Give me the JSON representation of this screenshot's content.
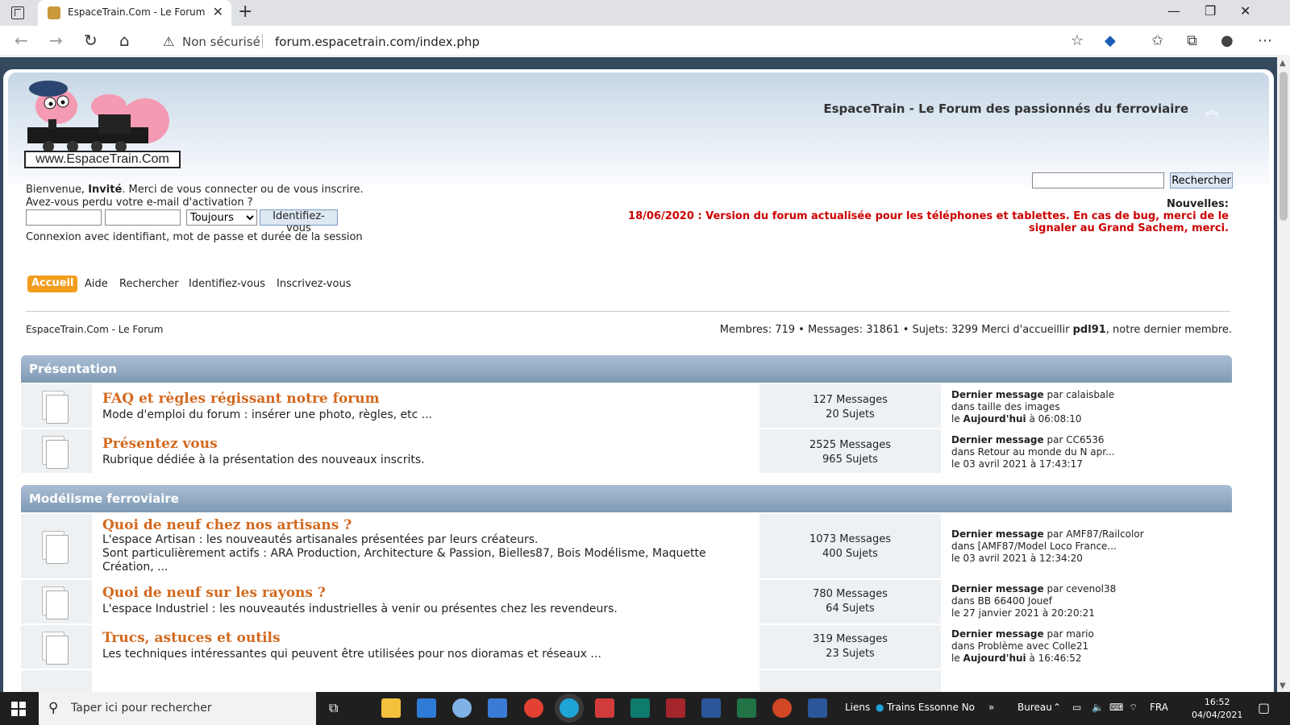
{
  "browser": {
    "tab_title": "EspaceTrain.Com - Le Forum - Accueil",
    "insecure_label": "Non sécurisé",
    "url": "forum.espacetrain.com/index.php"
  },
  "header": {
    "site_title": "EspaceTrain - Le Forum des passionnés du ferroviaire",
    "logo_text": "www.EspaceTrain.Com"
  },
  "login": {
    "welcome_prefix": "Bienvenue, ",
    "guest": "Invité",
    "welcome_suffix": ". Merci de vous connecter ou de vous inscrire.",
    "lost_email": "Avez-vous perdu votre e-mail d'activation ?",
    "duration_selected": "Toujours",
    "login_button": "Identifiez-vous",
    "session_note": "Connexion avec identifiant, mot de passe et durée de la session"
  },
  "search": {
    "button": "Rechercher"
  },
  "news": {
    "label": "Nouvelles:",
    "text": "18/06/2020 : Version du forum actualisée pour les téléphones et tablettes. En cas de bug, merci de le signaler au Grand Sachem, merci."
  },
  "menu": {
    "home": "Accueil",
    "help": "Aide",
    "search": "Rechercher",
    "login": "Identifiez-vous",
    "register": "Inscrivez-vous"
  },
  "breadcrumb": "EspaceTrain.Com - Le Forum",
  "stats": {
    "prefix": "Membres: 719  •  Messages: 31861  •  Sujets: 3299 Merci d'accueillir ",
    "newest_member": "pdl91",
    "suffix": ", notre dernier membre."
  },
  "categories": [
    {
      "name": "Présentation",
      "boards": [
        {
          "name": "FAQ et règles régissant notre forum",
          "desc": "Mode d'emploi du forum : insérer une photo, règles, etc ...",
          "messages": "127 Messages",
          "topics": "20 Sujets",
          "last_label": "Dernier message",
          "last_by": " par calaisbale",
          "last_in": "dans taille des images",
          "last_date_prefix": "le ",
          "last_date_bold": "Aujourd'hui",
          "last_date": " à 06:08:10"
        },
        {
          "name": "Présentez vous",
          "desc": "Rubrique dédiée à la présentation des nouveaux inscrits.",
          "messages": "2525 Messages",
          "topics": "965 Sujets",
          "last_label": "Dernier message",
          "last_by": " par CC6536",
          "last_in": "dans Retour au monde du N apr...",
          "last_date_prefix": "le 03 avril 2021 à 17:43:17",
          "last_date_bold": "",
          "last_date": ""
        }
      ]
    },
    {
      "name": "Modélisme ferroviaire",
      "boards": [
        {
          "name": "Quoi de neuf chez nos artisans ?",
          "desc": "L'espace Artisan : les nouveautés artisanales présentées par leurs créateurs.",
          "desc2": "Sont particulièrement actifs : ARA Production, Architecture & Passion, Bielles87, Bois Modélisme, Maquette Création, ...",
          "messages": "1073 Messages",
          "topics": "400 Sujets",
          "last_label": "Dernier message",
          "last_by": " par AMF87/Railcolor",
          "last_in": "dans [AMF87/Model Loco France...",
          "last_date_prefix": "le 03 avril 2021 à 12:34:20",
          "last_date_bold": "",
          "last_date": ""
        },
        {
          "name": "Quoi de neuf sur les rayons ?",
          "desc": "L'espace Industriel : les nouveautés industrielles à venir ou présentes chez les revendeurs.",
          "messages": "780 Messages",
          "topics": "64 Sujets",
          "last_label": "Dernier message",
          "last_by": " par cevenol38",
          "last_in": "dans BB 66400 Jouef",
          "last_date_prefix": "le 27 janvier 2021 à 20:20:21",
          "last_date_bold": "",
          "last_date": ""
        },
        {
          "name": "Trucs, astuces et outils",
          "desc": "Les techniques intéressantes qui peuvent être utilisées pour nos dioramas et réseaux ...",
          "messages": "319 Messages",
          "topics": "23 Sujets",
          "last_label": "Dernier message",
          "last_by": " par mario",
          "last_in": "dans Problème avec Colle21",
          "last_date_prefix": "le ",
          "last_date_bold": "Aujourd'hui",
          "last_date": " à 16:46:52"
        }
      ]
    }
  ],
  "taskbar": {
    "search_placeholder": "Taper ici pour rechercher",
    "links_label": "Liens",
    "trains_link": "Trains Essonne No",
    "desktop_label": "Bureau",
    "lang": "FRA",
    "time": "16:52",
    "date": "04/04/2021"
  }
}
